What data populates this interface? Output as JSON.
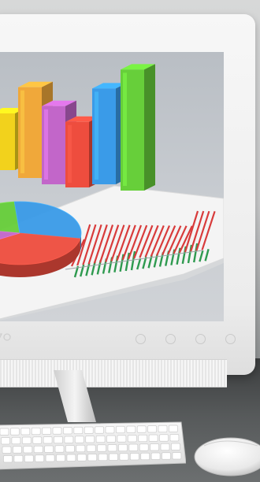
{
  "scene": {
    "description_free": true,
    "colors": {
      "bar_yellow": "#f2d21c",
      "bar_orange": "#f0a83a",
      "bar_violet": "#c266c9",
      "bar_red": "#ee4d3e",
      "bar_blue": "#3a9be8",
      "bar_green": "#67cf3a",
      "line_red": "#d83b3b",
      "line_green": "#2e9a4f",
      "screen_bg": "#c4c9cf",
      "bezel": "#f2f2f2"
    },
    "monitor": {
      "front_buttons": 4
    },
    "chart_on_screen": {
      "bar_count": 6,
      "bar_levels": [
        0.45,
        0.72,
        0.62,
        0.52,
        0.76,
        0.96
      ],
      "pie_slices": 4
    }
  }
}
